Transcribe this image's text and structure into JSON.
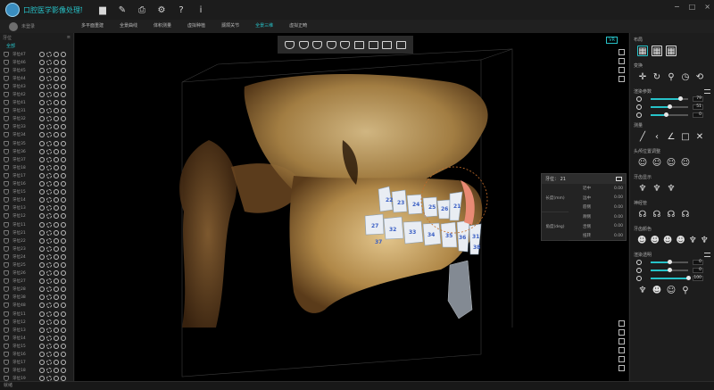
{
  "window": {
    "title": "口腔医学影像处理软件",
    "controls": [
      "−",
      "□",
      "×"
    ]
  },
  "toolbar": [
    {
      "icon": "folder-icon",
      "glyph": "▆"
    },
    {
      "icon": "edit-icon",
      "glyph": "✎"
    },
    {
      "icon": "print-icon",
      "glyph": "⎙"
    },
    {
      "icon": "gear-icon",
      "glyph": "⚙"
    },
    {
      "icon": "help-icon",
      "glyph": "?"
    },
    {
      "icon": "info-icon",
      "glyph": "i"
    }
  ],
  "user": {
    "name": "未登录"
  },
  "tabs": [
    {
      "label": "多平面重建",
      "active": false
    },
    {
      "label": "全景曲线",
      "active": false
    },
    {
      "label": "体积测量",
      "active": false
    },
    {
      "label": "虚拟种植",
      "active": false
    },
    {
      "label": "颞颌关节",
      "active": false
    },
    {
      "label": "全景三维",
      "active": true
    },
    {
      "label": "虚拟正畸",
      "active": false
    }
  ],
  "left_panel": {
    "header": "牙位",
    "group": "全部",
    "teeth": [
      "牙位47",
      "牙位46",
      "牙位45",
      "牙位44",
      "牙位43",
      "牙位42",
      "牙位41",
      "牙位31",
      "牙位32",
      "牙位33",
      "牙位34",
      "牙位35",
      "牙位36",
      "牙位37",
      "牙位18",
      "牙位17",
      "牙位16",
      "牙位15",
      "牙位14",
      "牙位13",
      "牙位12",
      "牙位11",
      "牙位21",
      "牙位22",
      "牙位23",
      "牙位24",
      "牙位25",
      "牙位26",
      "牙位27",
      "牙位28",
      "牙位38",
      "牙位48",
      "牙位11",
      "牙位12",
      "牙位13",
      "牙位14",
      "牙位15",
      "牙位16",
      "牙位17",
      "牙位18",
      "牙位19"
    ]
  },
  "viewport": {
    "view_tag": "VR",
    "tooth_labels": [
      "22",
      "23",
      "24",
      "25",
      "26",
      "27",
      "32",
      "33",
      "34",
      "35",
      "36",
      "37",
      "21",
      "31",
      "38"
    ]
  },
  "popup": {
    "title": "牙位：",
    "tooth": "21",
    "groups": [
      {
        "label": "长度(mm)",
        "rows": [
          {
            "k": "近中",
            "v": "0.00"
          },
          {
            "k": "远中",
            "v": "0.00"
          },
          {
            "k": "唇侧",
            "v": "0.00"
          }
        ]
      },
      {
        "label": "角度(deg)",
        "rows": [
          {
            "k": "颊侧",
            "v": "0.00"
          },
          {
            "k": "舌侧",
            "v": "0.00"
          },
          {
            "k": "扭转",
            "v": "0.00"
          }
        ]
      }
    ]
  },
  "right_panel": {
    "layout_title": "布局",
    "transform_title": "变换",
    "render_title": "渲染参数",
    "render_sliders": [
      {
        "icon": "sun-icon",
        "value": "79",
        "ratio": 0.79
      },
      {
        "icon": "contrast-icon",
        "value": "51",
        "ratio": 0.51
      },
      {
        "icon": "warning-icon",
        "value": "0",
        "ratio": 0.4
      }
    ],
    "measure_title": "测量",
    "pose_title": "头颅位置调整",
    "teeth_title": "牙齿显示",
    "nerve_title": "神经管",
    "implant_title": "牙齿颜色",
    "color_title": "渲染透明",
    "color_sliders": [
      {
        "icon": "sun-icon",
        "value": "0",
        "ratio": 0.5
      },
      {
        "icon": "contrast-icon",
        "value": "0",
        "ratio": 0.5
      },
      {
        "icon": "circle-icon",
        "value": "100",
        "ratio": 1.0
      }
    ]
  },
  "status": {
    "text": "就绪"
  },
  "colors": {
    "accent": "#27c2c8",
    "bone": "#c9a467",
    "gum": "#e98a74"
  }
}
